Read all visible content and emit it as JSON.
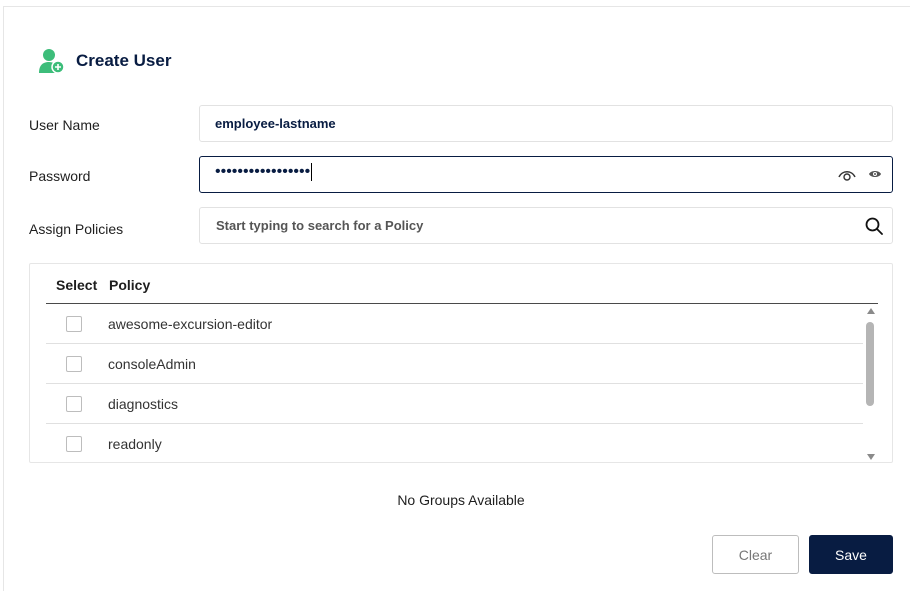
{
  "header": {
    "title": "Create User",
    "icon": "add-user-icon",
    "icon_color": "#3dbd7a"
  },
  "form": {
    "username_label": "User Name",
    "username_value": "employee-lastname",
    "password_label": "Password",
    "password_mask": "•••••••••••••••••",
    "policies_label": "Assign Policies",
    "policy_search_placeholder": "Start typing to search for a Policy"
  },
  "policy_table": {
    "headers": {
      "select": "Select",
      "policy": "Policy"
    },
    "rows": [
      {
        "name": "awesome-excursion-editor",
        "checked": false
      },
      {
        "name": "consoleAdmin",
        "checked": false
      },
      {
        "name": "diagnostics",
        "checked": false
      },
      {
        "name": "readonly",
        "checked": false
      }
    ]
  },
  "groups": {
    "empty_text": "No Groups Available"
  },
  "buttons": {
    "clear_label": "Clear",
    "save_label": "Save"
  },
  "colors": {
    "primary": "#081c42",
    "accent": "#3dbd7a"
  }
}
